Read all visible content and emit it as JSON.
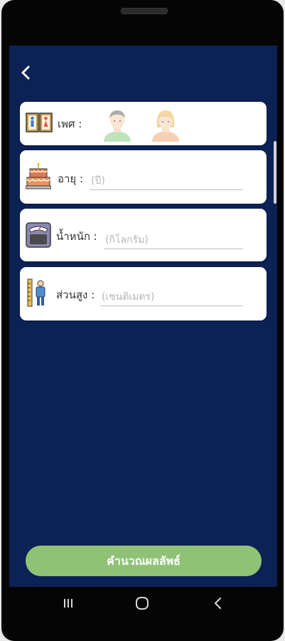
{
  "form": {
    "gender_label": "เพศ :",
    "age_label": "อายุ :",
    "age_placeholder": "(ปี)",
    "weight_label": "น้ำหนัก :",
    "weight_placeholder": "(กิโลกรัม)",
    "height_label": "ส่วนสูง :",
    "height_placeholder": "(เซนติเมตร)"
  },
  "calculate_button": "คำนวณผลลัพธ์",
  "icons": {
    "back": "chevron-left-icon",
    "gender": "gender-sign-icon",
    "male": "male-avatar-icon",
    "female": "female-avatar-icon",
    "age": "birthday-cake-icon",
    "weight": "weight-scale-icon",
    "height": "height-measure-icon"
  },
  "colors": {
    "screen_background": "#0c2154",
    "card_background": "#ffffff",
    "button_background": "#8fc275",
    "button_text": "#ffffff"
  }
}
